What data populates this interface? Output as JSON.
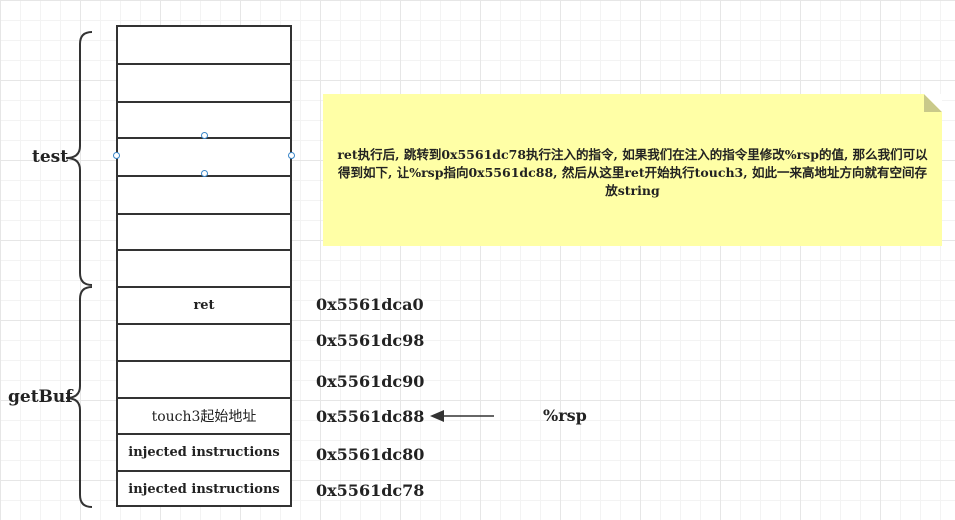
{
  "labels": {
    "test": "test",
    "getbuf": "getBuf"
  },
  "stack_cells": [
    "",
    "",
    "",
    "",
    "",
    "",
    "",
    "ret",
    "",
    "",
    "touch3起始地址",
    "injected instructions",
    "injected instructions"
  ],
  "addresses": [
    "0x5561dca0",
    "0x5561dc98",
    "0x5561dc90",
    "0x5561dc88",
    "0x5561dc80",
    "0x5561dc78"
  ],
  "note": {
    "text": "ret执行后, 跳转到0x5561dc78执行注入的指令, 如果我们在注入的指令里修改%rsp的值, 那么我们可以得到如下, 让%rsp指向0x5561dc88, 然后从这里ret开始执行touch3, 如此一来高地址方向就有空间存放string",
    "color": "#ffffa6"
  },
  "pointer_label": "%rsp"
}
